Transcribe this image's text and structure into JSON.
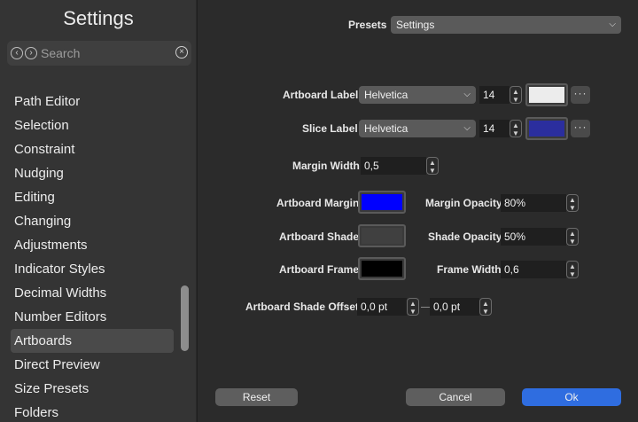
{
  "sidebar": {
    "title": "Settings",
    "search": {
      "placeholder": "Search"
    },
    "items": [
      {
        "label": "Path Editor"
      },
      {
        "label": "Selection"
      },
      {
        "label": "Constraint"
      },
      {
        "label": "Nudging"
      },
      {
        "label": "Editing"
      },
      {
        "label": "Changing"
      },
      {
        "label": "Adjustments"
      },
      {
        "label": "Indicator Styles"
      },
      {
        "label": "Decimal Widths"
      },
      {
        "label": "Number Editors"
      },
      {
        "label": "Artboards"
      },
      {
        "label": "Direct Preview"
      },
      {
        "label": "Size Presets"
      },
      {
        "label": "Folders"
      }
    ],
    "selected_index": 10
  },
  "presets": {
    "label": "Presets",
    "value": "Settings"
  },
  "artboard_label": {
    "label": "Artboard Label",
    "font": "Helvetica",
    "size": "14",
    "color": "#ececec"
  },
  "slice_label": {
    "label": "Slice Label",
    "font": "Helvetica",
    "size": "14",
    "color": "#2b2e9e"
  },
  "margin_width": {
    "label": "Margin Width",
    "value": "0,5"
  },
  "artboard_margin": {
    "label": "Artboard Margin",
    "color": "#0000ff"
  },
  "margin_opacity": {
    "label": "Margin Opacity",
    "value": "80%"
  },
  "artboard_shade": {
    "label": "Artboard Shade",
    "color": "#404040"
  },
  "shade_opacity": {
    "label": "Shade Opacity",
    "value": "50%"
  },
  "artboard_frame": {
    "label": "Artboard Frame",
    "color": "#000000"
  },
  "frame_width": {
    "label": "Frame Width",
    "value": "0,6"
  },
  "shade_offset": {
    "label": "Artboard Shade Offset",
    "x": "0,0 pt",
    "y": "0,0 pt"
  },
  "buttons": {
    "reset": "Reset",
    "cancel": "Cancel",
    "ok": "Ok"
  },
  "colors": {
    "accent": "#2f6de0"
  }
}
